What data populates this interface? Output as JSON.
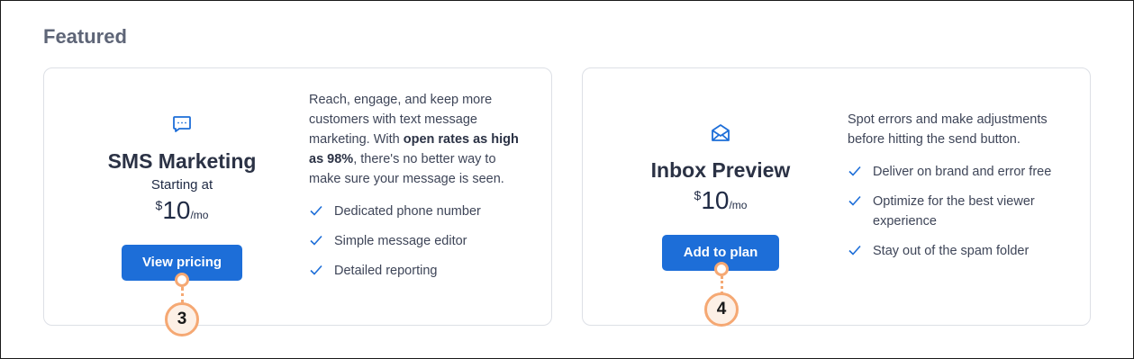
{
  "section": {
    "title": "Featured"
  },
  "sms": {
    "icon": "chat-bubble-icon",
    "name": "SMS Marketing",
    "starting_label": "Starting at",
    "currency": "$",
    "amount": "10",
    "period": "/mo",
    "button_label": "View pricing",
    "description_pre": "Reach, engage, and keep more customers with text message marketing. With ",
    "description_bold": "open rates as high as 98%",
    "description_post": ", there's no better way to make sure your message is seen.",
    "features": [
      "Dedicated phone number",
      "Simple message editor",
      "Detailed reporting"
    ]
  },
  "inbox": {
    "icon": "envelope-icon",
    "name": "Inbox Preview",
    "currency": "$",
    "amount": "10",
    "period": "/mo",
    "button_label": "Add to plan",
    "description": "Spot errors and make adjustments before hitting the send button.",
    "features": [
      "Deliver on brand and error free",
      "Optimize for the best viewer experience",
      "Stay out of the spam folder"
    ]
  },
  "callouts": [
    "3",
    "4"
  ],
  "colors": {
    "accent": "#1d6ed8",
    "callout": "#f5a873",
    "heading": "#5e6577"
  }
}
